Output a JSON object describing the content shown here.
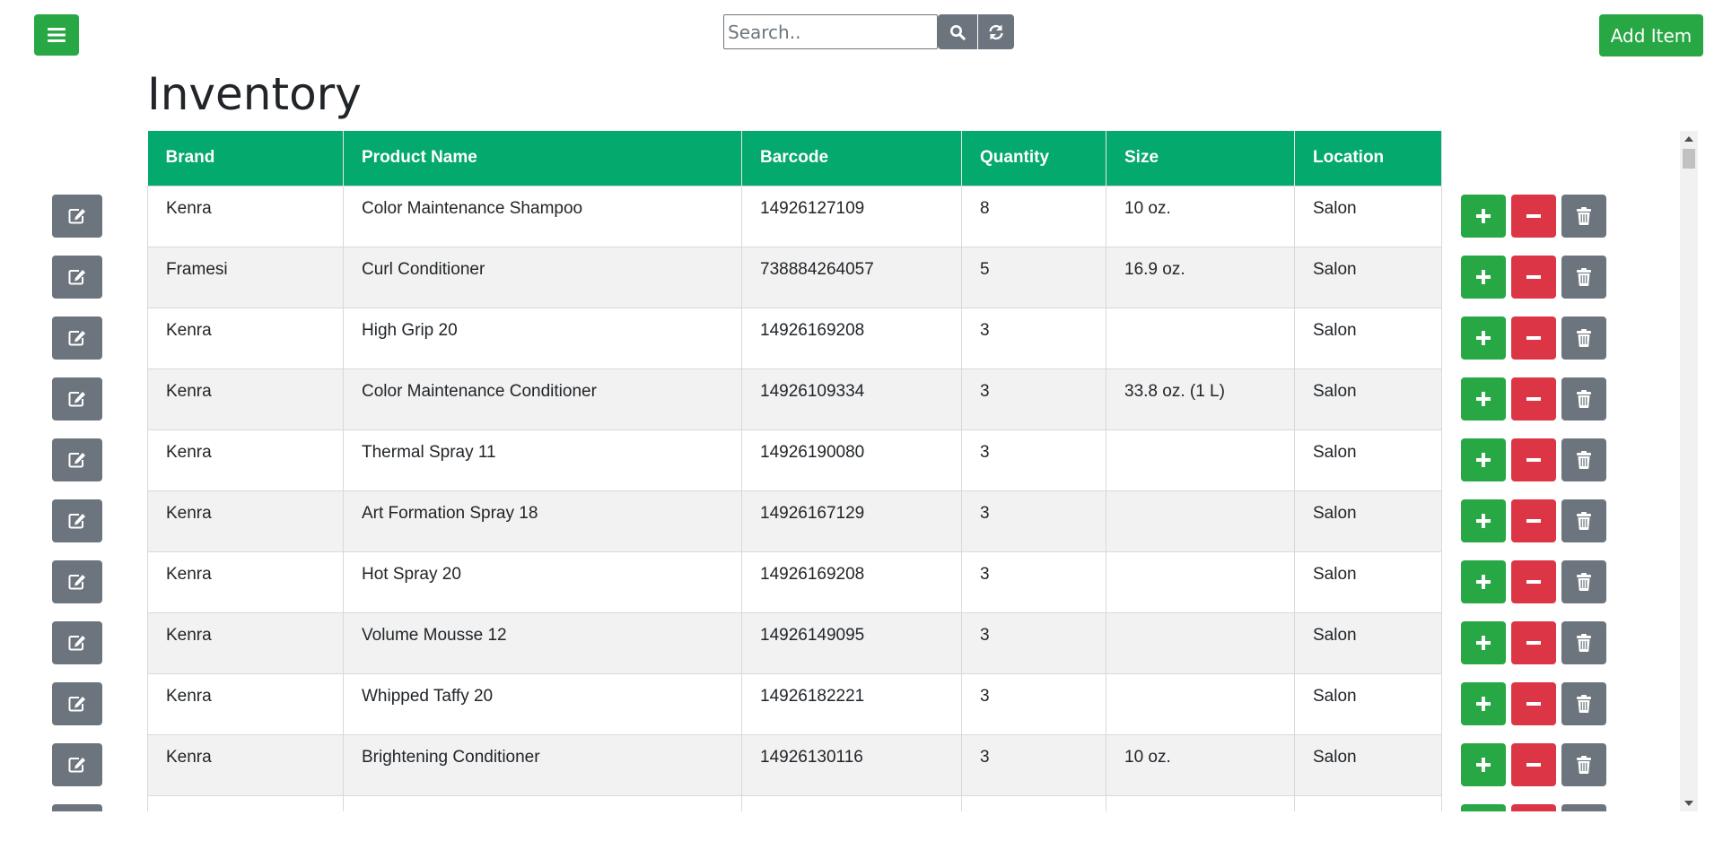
{
  "header": {
    "search_placeholder": "Search..",
    "add_item_label": "Add Item"
  },
  "page_title": "Inventory",
  "colors": {
    "header_green": "#04a96d",
    "button_green": "#28a745",
    "button_red": "#dc3545",
    "button_gray": "#6c757d"
  },
  "icons": {
    "menu": "hamburger-icon",
    "search": "magnifier-icon",
    "refresh": "refresh-icon",
    "edit": "edit-icon",
    "increment": "plus-icon",
    "decrement": "minus-icon",
    "delete": "trash-icon"
  },
  "table": {
    "columns": [
      "Brand",
      "Product Name",
      "Barcode",
      "Quantity",
      "Size",
      "Location"
    ],
    "rows": [
      [
        "Kenra",
        "Color Maintenance Shampoo",
        "14926127109",
        "8",
        "10 oz.",
        "Salon"
      ],
      [
        "Framesi",
        "Curl Conditioner",
        "738884264057",
        "5",
        "16.9 oz.",
        "Salon"
      ],
      [
        "Kenra",
        "High Grip 20",
        "14926169208",
        "3",
        "",
        "Salon"
      ],
      [
        "Kenra",
        "Color Maintenance Conditioner",
        "14926109334",
        "3",
        "33.8 oz. (1 L)",
        "Salon"
      ],
      [
        "Kenra",
        "Thermal Spray 11",
        "14926190080",
        "3",
        "",
        "Salon"
      ],
      [
        "Kenra",
        "Art Formation Spray 18",
        "14926167129",
        "3",
        "",
        "Salon"
      ],
      [
        "Kenra",
        "Hot Spray 20",
        "14926169208",
        "3",
        "",
        "Salon"
      ],
      [
        "Kenra",
        "Volume Mousse 12",
        "14926149095",
        "3",
        "",
        "Salon"
      ],
      [
        "Kenra",
        "Whipped Taffy 20",
        "14926182221",
        "3",
        "",
        "Salon"
      ],
      [
        "Kenra",
        "Brightening Conditioner",
        "14926130116",
        "3",
        "10 oz.",
        "Salon"
      ],
      [
        "",
        "",
        "",
        "",
        "",
        ""
      ]
    ]
  }
}
